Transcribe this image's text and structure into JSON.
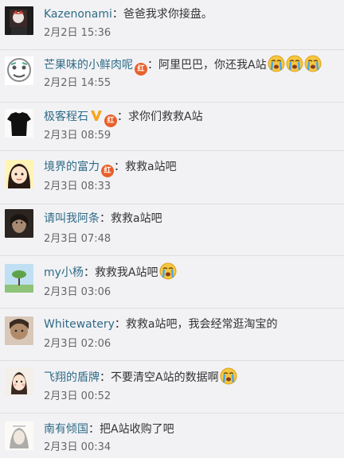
{
  "comments": [
    {
      "name": "Kazenonami",
      "separator": "：",
      "text": "爸爸我求你接盘。",
      "time": "2月2日 15:36"
    },
    {
      "name": "芒果味的小鲜肉呢",
      "badge": "红",
      "separator": "：",
      "text": "阿里巴巴，你还我A站",
      "time": "2月2日 14:55"
    },
    {
      "name": "极客程石",
      "badge": "红",
      "separator": "：",
      "text": "求你们救救A站",
      "time": "2月3日 08:59"
    },
    {
      "name": "境界的富力",
      "badge": "红",
      "separator": "：",
      "text": "救救a站吧",
      "time": "2月3日 08:33"
    },
    {
      "name": "请叫我阿条",
      "separator": "：",
      "text": "救救a站吧",
      "time": "2月3日 07:48"
    },
    {
      "name": "my小杨",
      "separator": "：",
      "text": "救救我A站吧",
      "time": "2月3日 03:06"
    },
    {
      "name": "Whitewatery",
      "separator": "：",
      "text": "救救a站吧，我会经常逛淘宝的",
      "time": "2月3日 02:06"
    },
    {
      "name": "飞翔的盾牌",
      "separator": "：",
      "text": "不要清空A站的数据啊",
      "time": "2月3日 00:52"
    },
    {
      "name": "南有倾国",
      "separator": "：",
      "text": "把A站收购了吧",
      "time": "2月3日 00:34"
    }
  ],
  "icons": {
    "crying_emoji": "crying-face-icon",
    "verified_badge": "verified-v-icon"
  },
  "colors": {
    "name": "#2f6b86",
    "badge": "#e8612a",
    "verified": "#f5a623",
    "time": "#666666"
  }
}
